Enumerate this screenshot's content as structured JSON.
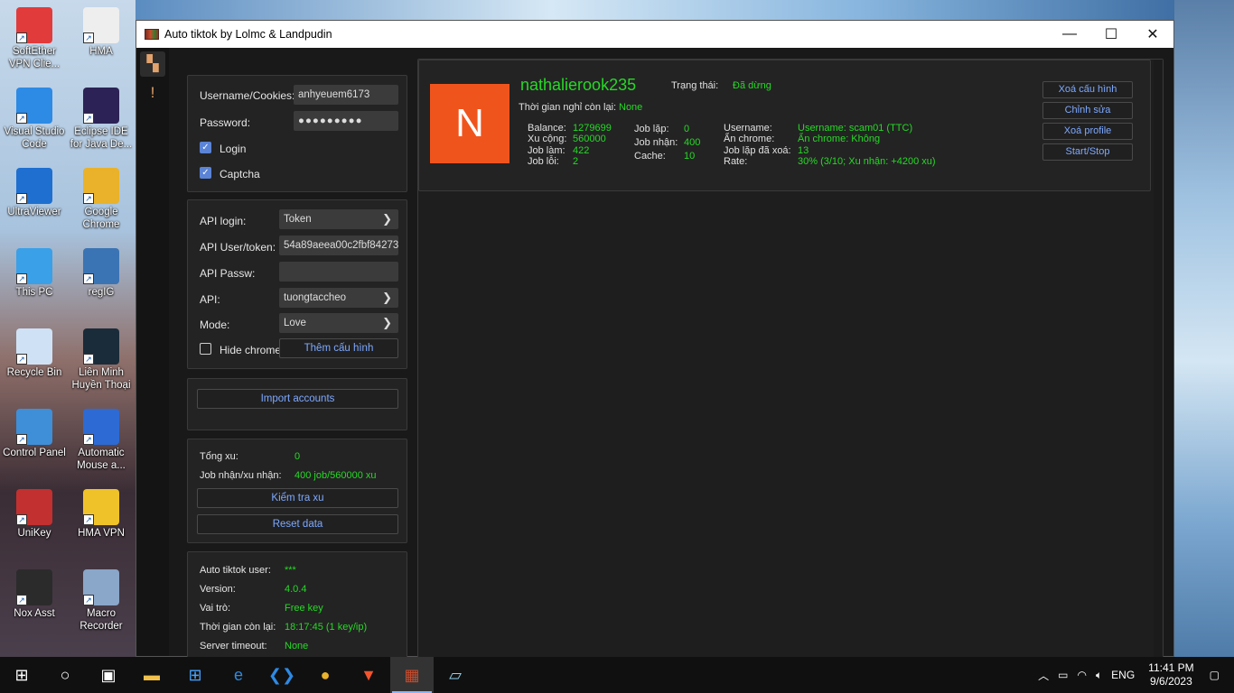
{
  "desktop": {
    "icons": [
      {
        "label": "SoftEther VPN Clie...",
        "color": "#e23b3b"
      },
      {
        "label": "HMA",
        "color": "#eeeeee"
      },
      {
        "label": "Visual Studio Code",
        "color": "#2d8ae5"
      },
      {
        "label": "Eclipse IDE for Java De...",
        "color": "#2c2255"
      },
      {
        "label": "UltraViewer",
        "color": "#1e6fd0"
      },
      {
        "label": "Google Chrome",
        "color": "#e9b22a"
      },
      {
        "label": "This PC",
        "color": "#3aa0e8"
      },
      {
        "label": "regIG",
        "color": "#3b74b4"
      },
      {
        "label": "Recycle Bin",
        "color": "#cfe2f5"
      },
      {
        "label": "Liên Minh Huyền Thoại",
        "color": "#1a2c3a"
      },
      {
        "label": "Control Panel",
        "color": "#3e8fd8"
      },
      {
        "label": "Automatic Mouse a...",
        "color": "#2d6ad4"
      },
      {
        "label": "UniKey",
        "color": "#c23030"
      },
      {
        "label": "HMA VPN",
        "color": "#f0c22a"
      },
      {
        "label": "Nox Asst",
        "color": "#2b2b2b"
      },
      {
        "label": "Macro Recorder",
        "color": "#8aa6c8"
      }
    ]
  },
  "window": {
    "title": "Auto tiktok by Lolmc & Landpudin",
    "minimize": "—",
    "maximize": "☐",
    "close": "✕"
  },
  "sidebar": {
    "icons": [
      "dashboard-icon",
      "report-icon"
    ]
  },
  "login_panel": {
    "username_label": "Username/Cookies:",
    "username_value": "anhyeuem6173",
    "password_label": "Password:",
    "password_value": "●●●●●●●●●",
    "login_label": "Login",
    "login_checked": true,
    "captcha_label": "Captcha",
    "captcha_checked": true
  },
  "api_panel": {
    "api_login_label": "API login:",
    "api_login_value": "Token",
    "api_user_label": "API User/token:",
    "api_user_value": "54a89aeea00c2fbf84273",
    "api_pass_label": "API Passw:",
    "api_pass_value": "",
    "api_label": "API:",
    "api_value": "tuongtaccheo",
    "mode_label": "Mode:",
    "mode_value": "Love",
    "hide_chrome_label": "Hide chrome",
    "hide_chrome_checked": false,
    "add_config_label": "Thêm cấu hình"
  },
  "import_panel": {
    "import_label": "Import accounts"
  },
  "stats_panel": {
    "tong_xu_label": "Tổng xu:",
    "tong_xu_value": "0",
    "job_label": "Job nhận/xu nhận:",
    "job_value": "400 job/560000 xu",
    "check_label": "Kiểm tra xu",
    "reset_label": "Reset data"
  },
  "info_panel": {
    "user_label": "Auto tiktok user:",
    "user_value": "***",
    "version_label": "Version:",
    "version_value": "4.0.4",
    "role_label": "Vai trò:",
    "role_value": "Free key",
    "time_label": "Thời gian còn lại:",
    "time_value": "18:17:45 (1 key/ip)",
    "server_label": "Server timeout:",
    "server_value": "None"
  },
  "account_card": {
    "avatar_letter": "N",
    "username": "nathalierook235",
    "status_label": "Trạng thái:",
    "status_value": "Đã dừng",
    "rest_label": "Thời gian nghỉ còn lại:",
    "rest_value": "None",
    "balance_label": "Balance:",
    "balance_value": "1279699",
    "xu_cong_label": "Xu cộng:",
    "xu_cong_value": "560000",
    "job_lam_label": "Job làm:",
    "job_lam_value": "422",
    "job_loi_label": "Job lỗi:",
    "job_loi_value": "2",
    "job_lap_label": "Job lặp:",
    "job_lap_value": "0",
    "job_nhan_label": "Job nhận:",
    "job_nhan_value": "400",
    "cache_label": "Cache:",
    "cache_value": "10",
    "c_username_label": "Username:",
    "c_username_value": "Username: scam01 (TTC)",
    "an_chrome_label": "Ẩn chrome:",
    "an_chrome_value": "Ẩn chrome: Không",
    "job_lap_xoa_label": "Job lặp đã xoá:",
    "job_lap_xoa_value": "13",
    "rate_label": "Rate:",
    "rate_value": "30% (3/10; Xu nhận: +4200 xu)",
    "btn_delete_config": "Xoá cấu hình",
    "btn_edit": "Chỉnh sửa",
    "btn_delete_profile": "Xoá profile",
    "btn_start_stop": "Start/Stop"
  },
  "taskbar": {
    "lang": "ENG",
    "time": "11:41 PM",
    "date": "9/6/2023"
  }
}
